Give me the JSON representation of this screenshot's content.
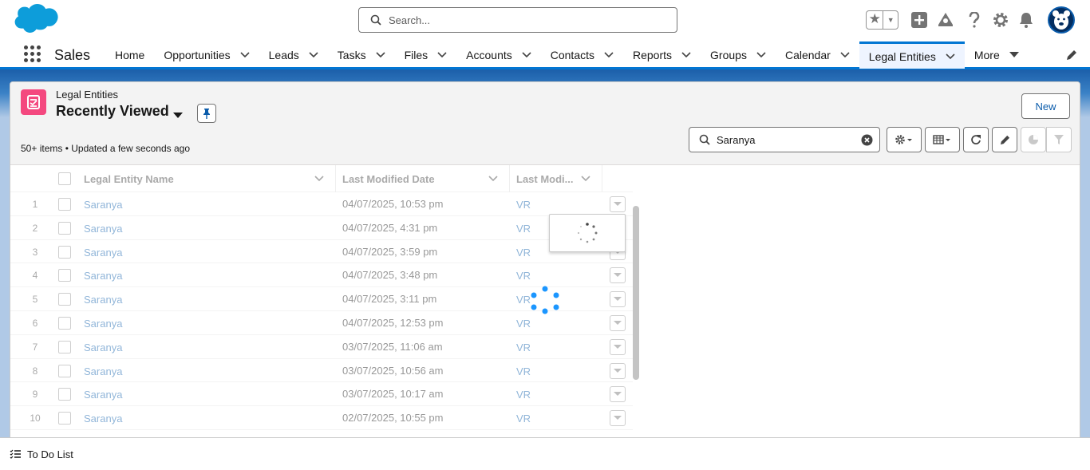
{
  "header": {
    "search_placeholder": "Search...",
    "icons": [
      "favorites-star-icon",
      "favorites-dropdown-icon",
      "global-actions-add-icon",
      "trailhead-icon",
      "help-icon",
      "setup-gear-icon",
      "notifications-bell-icon",
      "user-avatar"
    ]
  },
  "nav": {
    "app_name": "Sales",
    "tabs": [
      {
        "label": "Home",
        "chevron": false,
        "active": false
      },
      {
        "label": "Opportunities",
        "chevron": true,
        "active": false
      },
      {
        "label": "Leads",
        "chevron": true,
        "active": false
      },
      {
        "label": "Tasks",
        "chevron": true,
        "active": false
      },
      {
        "label": "Files",
        "chevron": true,
        "active": false
      },
      {
        "label": "Accounts",
        "chevron": true,
        "active": false
      },
      {
        "label": "Contacts",
        "chevron": true,
        "active": false
      },
      {
        "label": "Reports",
        "chevron": true,
        "active": false
      },
      {
        "label": "Groups",
        "chevron": true,
        "active": false
      },
      {
        "label": "Calendar",
        "chevron": true,
        "active": false
      },
      {
        "label": "Legal Entities",
        "chevron": true,
        "active": true
      },
      {
        "label": "More",
        "chevron": true,
        "active": false
      }
    ]
  },
  "listview": {
    "object_label": "Legal Entities",
    "view_name": "Recently Viewed",
    "new_button": "New",
    "status": "50+ items • Updated a few seconds ago",
    "search_value": "Saranya"
  },
  "table": {
    "columns": [
      "Legal Entity Name",
      "Last Modified Date",
      "Last Modi..."
    ],
    "rows": [
      {
        "n": "1",
        "name": "Saranya",
        "date": "04/07/2025, 10:53 pm",
        "by": "VR"
      },
      {
        "n": "2",
        "name": "Saranya",
        "date": "04/07/2025, 4:31 pm",
        "by": "VR"
      },
      {
        "n": "3",
        "name": "Saranya",
        "date": "04/07/2025, 3:59 pm",
        "by": "VR"
      },
      {
        "n": "4",
        "name": "Saranya",
        "date": "04/07/2025, 3:48 pm",
        "by": "VR"
      },
      {
        "n": "5",
        "name": "Saranya",
        "date": "04/07/2025, 3:11 pm",
        "by": "VR"
      },
      {
        "n": "6",
        "name": "Saranya",
        "date": "04/07/2025, 12:53 pm",
        "by": "VR"
      },
      {
        "n": "7",
        "name": "Saranya",
        "date": "03/07/2025, 11:06 am",
        "by": "VR"
      },
      {
        "n": "8",
        "name": "Saranya",
        "date": "03/07/2025, 10:56 am",
        "by": "VR"
      },
      {
        "n": "9",
        "name": "Saranya",
        "date": "03/07/2025, 10:17 am",
        "by": "VR"
      },
      {
        "n": "10",
        "name": "Saranya",
        "date": "02/07/2025, 10:55 pm",
        "by": "VR"
      }
    ]
  },
  "footer": {
    "label": "To Do List"
  }
}
